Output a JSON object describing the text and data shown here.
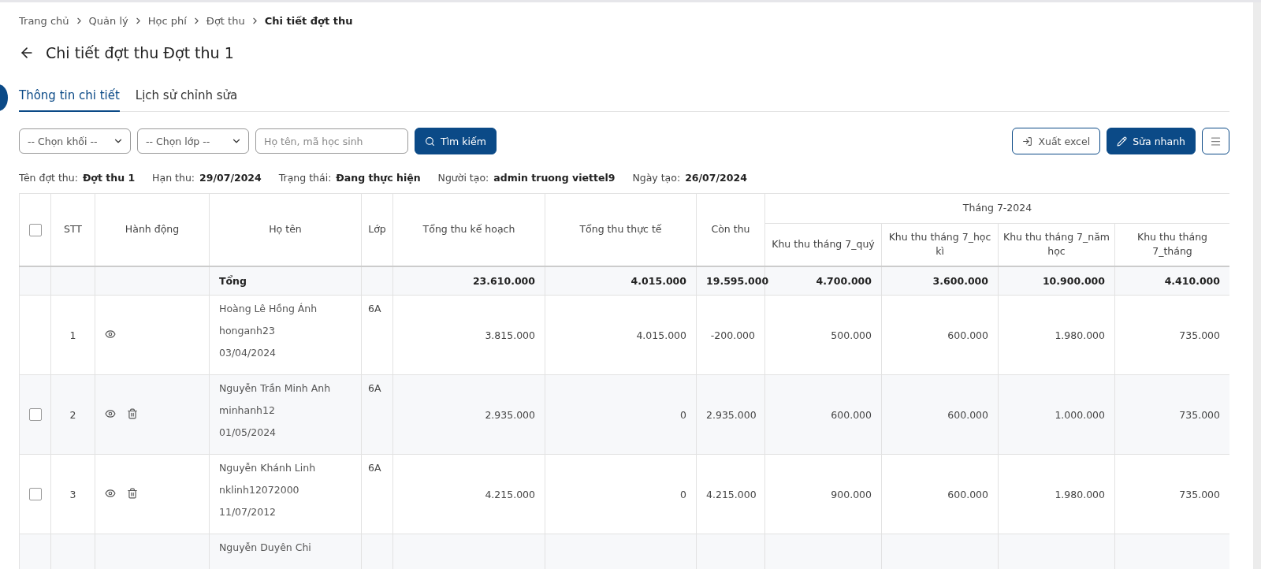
{
  "breadcrumb": [
    {
      "label": "Trang chủ",
      "current": false
    },
    {
      "label": "Quản lý",
      "current": false
    },
    {
      "label": "Học phí",
      "current": false
    },
    {
      "label": "Đợt thu",
      "current": false
    },
    {
      "label": "Chi tiết đợt thu",
      "current": true
    }
  ],
  "title": "Chi tiết đợt thu Đợt thu 1",
  "tabs": [
    {
      "label": "Thông tin chi tiết",
      "selected": true
    },
    {
      "label": "Lịch sử chỉnh sửa",
      "selected": false
    }
  ],
  "filters": {
    "grade_select": "-- Chọn khối --",
    "class_select": "-- Chọn lớp --",
    "search": {
      "placeholder": "Họ tên, mã học sinh"
    },
    "search_button": "Tìm kiếm"
  },
  "actions": [
    {
      "kind": "export",
      "label": "Xuất excel"
    },
    {
      "kind": "edit",
      "label": "Sửa nhanh"
    },
    {
      "kind": "menu"
    }
  ],
  "info": [
    {
      "label": "Tên đợt thu:",
      "value": "Đợt thu 1"
    },
    {
      "label": "Hạn thu:",
      "value": "29/07/2024"
    },
    {
      "label": "Trạng thái:",
      "value": "Đang thực hiện"
    },
    {
      "label": "Người tạo:",
      "value": "admin truong viettel9"
    },
    {
      "label": "Ngày tạo:",
      "value": "26/07/2024"
    }
  ],
  "table": {
    "select_all": {
      "checked": false
    },
    "columns": [
      "STT",
      "Hành động",
      "Họ tên",
      "Lớp",
      "Tổng thu kế hoạch",
      "Tổng thu thực tế",
      "Còn thu"
    ],
    "group": {
      "label": "Tháng 7-2024",
      "columns": [
        "Khu thu tháng 7_quý",
        "Khu thu tháng 7_học kì",
        "Khu thu tháng 7_năm học",
        "Khu thu tháng 7_tháng"
      ]
    },
    "total": {
      "label": "Tổng",
      "values": [
        "23.610.000",
        "4.015.000",
        "19.595.000",
        "4.700.000",
        "3.600.000",
        "10.900.000",
        "4.410.000"
      ]
    },
    "rows": [
      {
        "stt": "1",
        "checkbox": false,
        "deletable": false,
        "name": "Hoàng Lê Hồng Ánh",
        "username": "honganh23",
        "date": "03/04/2024",
        "class": "6A",
        "amounts": [
          "3.815.000",
          "4.015.000",
          "-200.000",
          "500.000",
          "600.000",
          "1.980.000",
          "735.000"
        ]
      },
      {
        "stt": "2",
        "checkbox": true,
        "checked": false,
        "deletable": true,
        "name": "Nguyễn Trần Minh Anh",
        "username": "minhanh12",
        "date": "01/05/2024",
        "class": "6A",
        "amounts": [
          "2.935.000",
          "0",
          "2.935.000",
          "600.000",
          "600.000",
          "1.000.000",
          "735.000"
        ]
      },
      {
        "stt": "3",
        "checkbox": true,
        "checked": false,
        "deletable": true,
        "name": "Nguyễn Khánh Linh",
        "username": "nklinh12072000",
        "date": "11/07/2012",
        "class": "6A",
        "amounts": [
          "4.215.000",
          "0",
          "4.215.000",
          "900.000",
          "600.000",
          "1.980.000",
          "735.000"
        ]
      },
      {
        "name": "Nguyễn Duyên Chi"
      }
    ]
  }
}
